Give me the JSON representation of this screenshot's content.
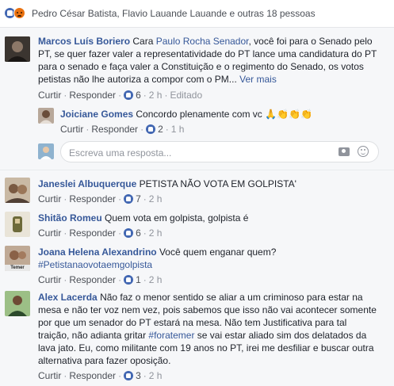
{
  "reactions_bar": {
    "icons": [
      "like-icon",
      "angry-icon"
    ],
    "text": "Pedro César Batista, Flavio Lauande Lauande e outras 18 pessoas"
  },
  "labels": {
    "like": "Curtir",
    "reply": "Responder",
    "dot": "·"
  },
  "comments": [
    {
      "author": "Marcos Luís Boriero",
      "pre": "Cara ",
      "mention": "Paulo Rocha Senador",
      "post": ", você foi para o Senado pelo PT, se quer fazer valer a representatividade do PT lance uma candidatura do PT para o senado e faça valer a Constituição e o regimento do Senado, os votos petistas não lhe autoriza a compor com o PM...",
      "more": " Ver mais",
      "likes": "6",
      "time": "2 h",
      "edited": "Editado"
    },
    {
      "author": "Joiciane Gomes",
      "text": "Concordo plenamente com vc 🙏👏👏👏",
      "likes": "2",
      "time": "1 h"
    },
    {
      "author": "Janeslei Albuquerque",
      "text": "PETISTA NÃO VOTA EM GOLPISTA'",
      "likes": "7",
      "time": "2 h"
    },
    {
      "author": "Shitão Romeu",
      "text": "Quem vota em golpista, golpista é",
      "likes": "6",
      "time": "2 h"
    },
    {
      "author": "Joana Helena Alexandrino",
      "text": "Você quem enganar quem?",
      "hashtag": "#Petistanaovotaemgolpista",
      "avatar_caption": "Temer",
      "likes": "1",
      "time": "2 h"
    },
    {
      "author": "Alex Lacerda",
      "pre": "Não faz o menor sentido se aliar a um criminoso para estar na mesa e não ter voz nem vez, pois sabemos que isso não vai acontecer somente por que um senador do PT estará na mesa. Não tem Justificativa para tal traição, não adianta gritar ",
      "hashtag": "#foratemer",
      "post": " se vai estar aliado sim dos delatados da lava jato. Eu, como militante com 19 anos no PT, irei me desfiliar e buscar outra alternativa para fazer oposição.",
      "likes": "3",
      "time": "2 h"
    }
  ],
  "reply_box": {
    "placeholder": "Escreva uma resposta...",
    "icons": [
      "camera-icon",
      "emoji-icon"
    ]
  },
  "colors": {
    "link": "#365899",
    "like_blue": "#4267b2",
    "meta": "#90949c"
  }
}
